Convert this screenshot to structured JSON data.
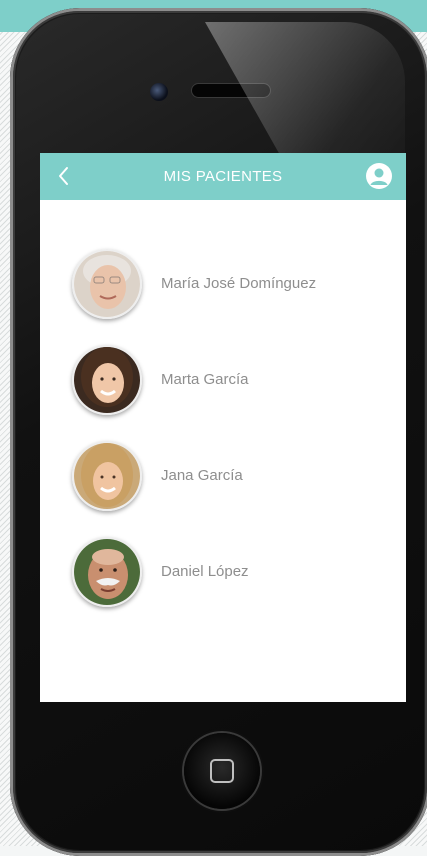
{
  "header": {
    "title": "MIS PACIENTES",
    "back_icon": "chevron-left-icon",
    "profile_icon": "user-circle-icon"
  },
  "patients": [
    {
      "name": "María José Domínguez",
      "avatar": "avatar-elderly-woman"
    },
    {
      "name": "Marta García",
      "avatar": "avatar-young-woman"
    },
    {
      "name": "Jana García",
      "avatar": "avatar-blonde-woman"
    },
    {
      "name": "Daniel López",
      "avatar": "avatar-elderly-man"
    }
  ],
  "colors": {
    "accent": "#7ecfc9",
    "name_text": "#8e8e8e",
    "screen_bg": "#ffffff"
  }
}
